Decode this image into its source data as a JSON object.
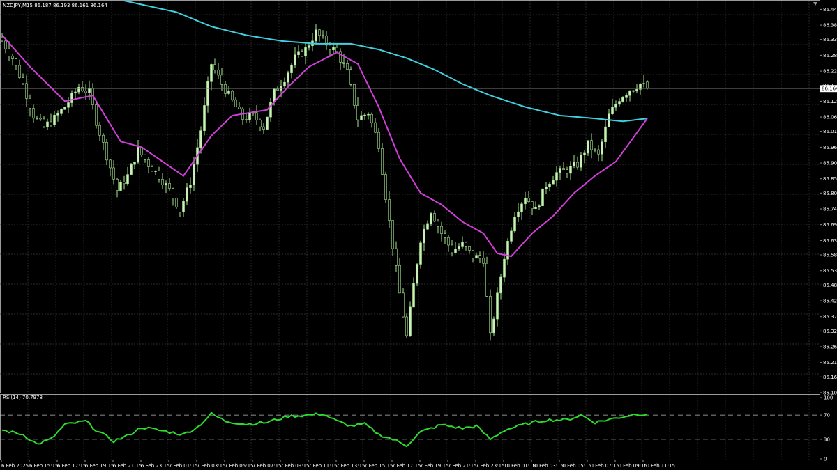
{
  "header": {
    "symbol_line": "NZDJPY,M15  86.187 86.193 86.161 86.164"
  },
  "price_axis": {
    "ticks": [
      "86.440",
      "86.385",
      "86.335",
      "86.280",
      "86.225",
      "86.175",
      "86.120",
      "86.065",
      "86.015",
      "85.960",
      "85.905",
      "85.850",
      "85.800",
      "85.745",
      "85.690",
      "85.635",
      "85.585",
      "85.530",
      "85.480",
      "85.425",
      "85.370",
      "85.320",
      "85.265",
      "85.210",
      "85.160",
      "85.105"
    ],
    "current_price_label": "86.164"
  },
  "rsi_panel": {
    "label": "RSI(14) 70.7978",
    "ticks": [
      "100",
      "70",
      "30",
      "0"
    ]
  },
  "time_axis": {
    "ticks": [
      "6 Feb 2025",
      "6 Feb 15:15",
      "6 Feb 17:15",
      "6 Feb 19:15",
      "6 Feb 21:15",
      "6 Feb 23:15",
      "7 Feb 01:15",
      "7 Feb 03:15",
      "7 Feb 05:15",
      "7 Feb 07:15",
      "7 Feb 09:15",
      "7 Feb 11:15",
      "7 Feb 13:15",
      "7 Feb 15:15",
      "7 Feb 17:15",
      "7 Feb 19:15",
      "7 Feb 21:15",
      "7 Feb 23:15",
      "10 Feb 01:15",
      "10 Feb 03:15",
      "10 Feb 05:15",
      "10 Feb 07:15",
      "10 Feb 09:15",
      "10 Feb 11:15"
    ]
  },
  "colors": {
    "background": "#000000",
    "grid": "#3a3a3a",
    "bull_candle": "#c8f0b8",
    "bear_candle": "#000000",
    "wick": "#a8e890",
    "ma_slow": "#40d0e0",
    "ma_fast": "#d040d8",
    "rsi_line": "#2edc2e",
    "axis_text": "#ffffff"
  },
  "chart_data": {
    "type": "candlestick",
    "symbol": "NZDJPY",
    "timeframe": "M15",
    "ohlc_last": {
      "open": 86.187,
      "high": 86.193,
      "low": 86.161,
      "close": 86.164
    },
    "ylim": [
      85.105,
      86.47
    ],
    "keypoints_close": [
      [
        0,
        86.33
      ],
      [
        3,
        86.27
      ],
      [
        6,
        86.18
      ],
      [
        9,
        86.07
      ],
      [
        12,
        86.03
      ],
      [
        15,
        86.06
      ],
      [
        18,
        86.1
      ],
      [
        22,
        86.17
      ],
      [
        25,
        86.15
      ],
      [
        27,
        86.05
      ],
      [
        30,
        85.93
      ],
      [
        33,
        85.81
      ],
      [
        36,
        85.86
      ],
      [
        39,
        85.95
      ],
      [
        42,
        85.9
      ],
      [
        45,
        85.86
      ],
      [
        48,
        85.81
      ],
      [
        51,
        85.74
      ],
      [
        54,
        85.84
      ],
      [
        57,
        86.02
      ],
      [
        60,
        86.25
      ],
      [
        63,
        86.18
      ],
      [
        66,
        86.12
      ],
      [
        69,
        86.06
      ],
      [
        72,
        86.07
      ],
      [
        75,
        86.03
      ],
      [
        78,
        86.15
      ],
      [
        81,
        86.2
      ],
      [
        84,
        86.27
      ],
      [
        87,
        86.3
      ],
      [
        90,
        86.36
      ],
      [
        93,
        86.32
      ],
      [
        96,
        86.29
      ],
      [
        99,
        86.22
      ],
      [
        102,
        86.06
      ],
      [
        105,
        86.08
      ],
      [
        108,
        85.97
      ],
      [
        111,
        85.7
      ],
      [
        114,
        85.45
      ],
      [
        116,
        85.3
      ],
      [
        118,
        85.48
      ],
      [
        120,
        85.64
      ],
      [
        123,
        85.74
      ],
      [
        126,
        85.66
      ],
      [
        129,
        85.6
      ],
      [
        132,
        85.62
      ],
      [
        135,
        85.58
      ],
      [
        138,
        85.57
      ],
      [
        140,
        85.3
      ],
      [
        142,
        85.44
      ],
      [
        144,
        85.58
      ],
      [
        147,
        85.73
      ],
      [
        150,
        85.79
      ],
      [
        153,
        85.74
      ],
      [
        156,
        85.83
      ],
      [
        159,
        85.87
      ],
      [
        162,
        85.88
      ],
      [
        165,
        85.9
      ],
      [
        168,
        85.97
      ],
      [
        171,
        85.93
      ],
      [
        174,
        86.07
      ],
      [
        177,
        86.13
      ],
      [
        180,
        86.16
      ],
      [
        183,
        86.18
      ],
      [
        185,
        86.164
      ]
    ],
    "keypoints_ma_fast": [
      [
        0,
        86.35
      ],
      [
        8,
        86.24
      ],
      [
        18,
        86.12
      ],
      [
        26,
        86.14
      ],
      [
        34,
        85.98
      ],
      [
        40,
        85.96
      ],
      [
        46,
        85.91
      ],
      [
        52,
        85.86
      ],
      [
        60,
        86.0
      ],
      [
        66,
        86.07
      ],
      [
        76,
        86.09
      ],
      [
        82,
        86.17
      ],
      [
        88,
        86.24
      ],
      [
        96,
        86.29
      ],
      [
        102,
        86.25
      ],
      [
        108,
        86.1
      ],
      [
        114,
        85.92
      ],
      [
        120,
        85.8
      ],
      [
        126,
        85.76
      ],
      [
        132,
        85.7
      ],
      [
        138,
        85.66
      ],
      [
        142,
        85.59
      ],
      [
        146,
        85.58
      ],
      [
        152,
        85.66
      ],
      [
        158,
        85.72
      ],
      [
        164,
        85.8
      ],
      [
        170,
        85.86
      ],
      [
        176,
        85.91
      ],
      [
        182,
        86.01
      ],
      [
        185,
        86.06
      ]
    ],
    "keypoints_ma_slow": [
      [
        35,
        86.47
      ],
      [
        50,
        86.43
      ],
      [
        60,
        86.38
      ],
      [
        70,
        86.35
      ],
      [
        80,
        86.33
      ],
      [
        90,
        86.32
      ],
      [
        100,
        86.32
      ],
      [
        108,
        86.3
      ],
      [
        116,
        86.27
      ],
      [
        124,
        86.23
      ],
      [
        132,
        86.18
      ],
      [
        140,
        86.14
      ],
      [
        150,
        86.1
      ],
      [
        160,
        86.07
      ],
      [
        170,
        86.06
      ],
      [
        178,
        86.05
      ],
      [
        185,
        86.06
      ]
    ],
    "rsi_ylim": [
      0,
      100
    ],
    "rsi_levels": [
      70,
      30
    ],
    "keypoints_rsi": [
      [
        0,
        45
      ],
      [
        6,
        38
      ],
      [
        10,
        22
      ],
      [
        14,
        30
      ],
      [
        18,
        54
      ],
      [
        24,
        60
      ],
      [
        27,
        45
      ],
      [
        32,
        27
      ],
      [
        36,
        36
      ],
      [
        40,
        50
      ],
      [
        46,
        44
      ],
      [
        52,
        38
      ],
      [
        56,
        50
      ],
      [
        60,
        72
      ],
      [
        64,
        60
      ],
      [
        70,
        55
      ],
      [
        76,
        58
      ],
      [
        82,
        68
      ],
      [
        88,
        70
      ],
      [
        92,
        72
      ],
      [
        96,
        60
      ],
      [
        100,
        52
      ],
      [
        104,
        55
      ],
      [
        108,
        38
      ],
      [
        112,
        30
      ],
      [
        116,
        20
      ],
      [
        120,
        42
      ],
      [
        126,
        54
      ],
      [
        132,
        48
      ],
      [
        136,
        52
      ],
      [
        140,
        30
      ],
      [
        144,
        45
      ],
      [
        150,
        55
      ],
      [
        156,
        62
      ],
      [
        162,
        62
      ],
      [
        166,
        70
      ],
      [
        170,
        58
      ],
      [
        176,
        65
      ],
      [
        182,
        72
      ],
      [
        185,
        70.8
      ]
    ]
  }
}
